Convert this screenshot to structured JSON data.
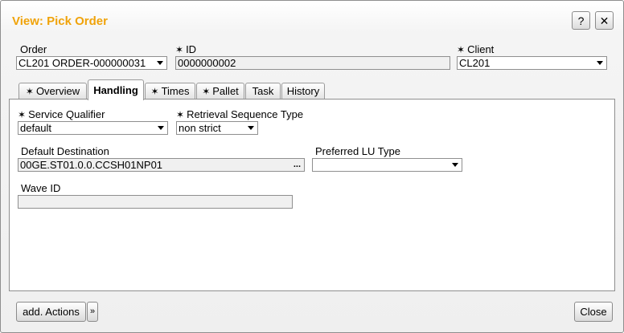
{
  "window": {
    "title": "View: Pick Order",
    "help_label": "?",
    "close_label": "✕"
  },
  "header": {
    "order_label": "Order",
    "order_value": "CL201 ORDER-000000031",
    "id_label": "ID",
    "id_value": "0000000002",
    "client_label": "Client",
    "client_value": "CL201",
    "required_mark": "✶"
  },
  "tabs": [
    {
      "label": "Overview",
      "required": true
    },
    {
      "label": "Handling",
      "required": false,
      "active": true
    },
    {
      "label": "Times",
      "required": true
    },
    {
      "label": "Pallet",
      "required": true
    },
    {
      "label": "Task",
      "required": false
    },
    {
      "label": "History",
      "required": false
    }
  ],
  "handling": {
    "service_qualifier_label": "Service Qualifier",
    "service_qualifier_value": "default",
    "retrieval_sequence_label": "Retrieval Sequence Type",
    "retrieval_sequence_value": "non strict",
    "default_destination_label": "Default Destination",
    "default_destination_value": "00GE.ST01.0.0.CCSH01NP01",
    "browse_label": "...",
    "preferred_lu_label": "Preferred LU Type",
    "preferred_lu_value": "",
    "wave_id_label": "Wave ID",
    "wave_id_value": ""
  },
  "footer": {
    "add_actions_label": "add. Actions",
    "more_label": "»",
    "close_label": "Close"
  }
}
